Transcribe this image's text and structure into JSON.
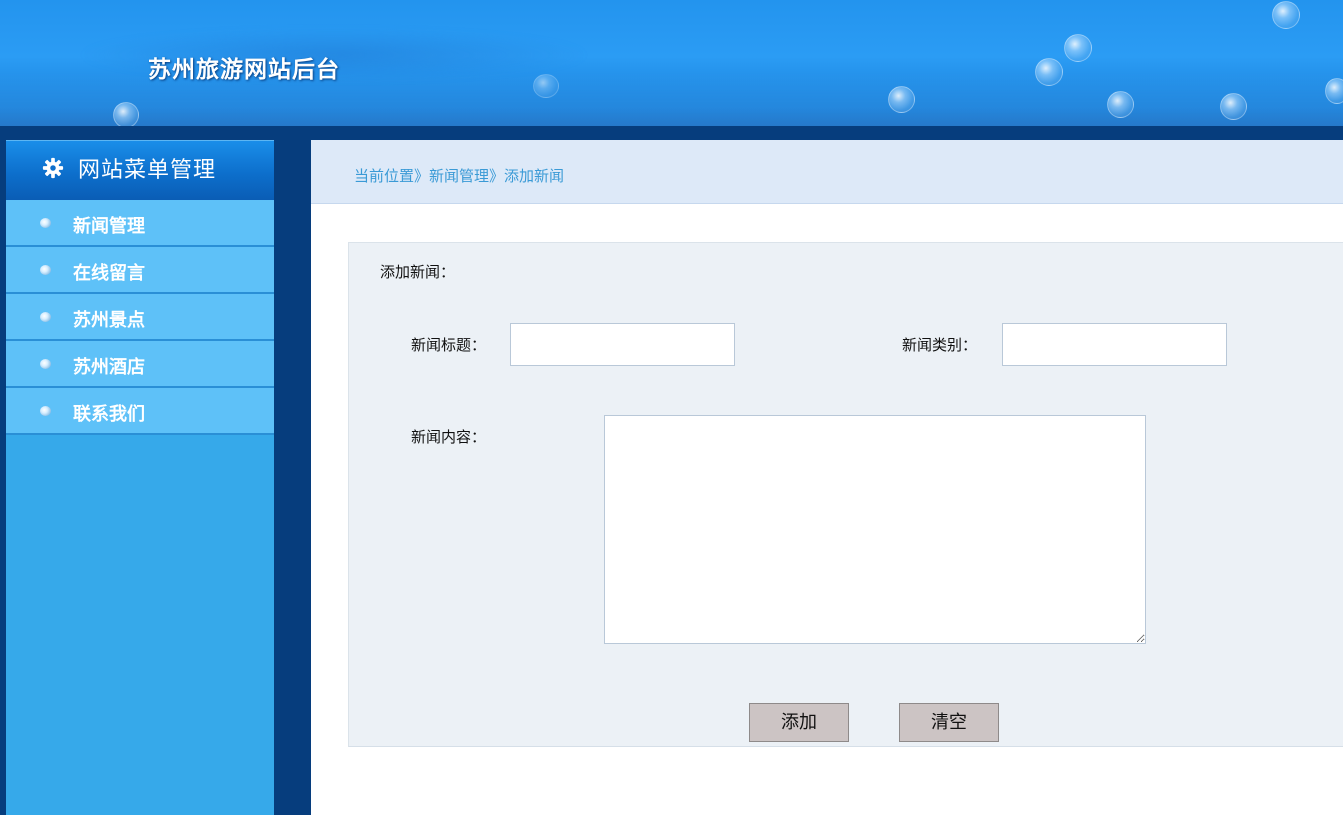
{
  "header": {
    "site_title": "苏州旅游网站后台"
  },
  "sidebar": {
    "title": "网站菜单管理",
    "title_icon": "gear-icon",
    "items": [
      {
        "label": "新闻管理"
      },
      {
        "label": "在线留言"
      },
      {
        "label": "苏州景点"
      },
      {
        "label": "苏州酒店"
      },
      {
        "label": "联系我们"
      }
    ]
  },
  "breadcrumb": {
    "text": "当前位置》新闻管理》添加新闻"
  },
  "form": {
    "heading": "添加新闻：",
    "title_label": "新闻标题：",
    "title_value": "",
    "category_label": "新闻类别：",
    "category_value": "",
    "content_label": "新闻内容：",
    "content_value": "",
    "add_button": "添加",
    "clear_button": "清空"
  },
  "colors": {
    "header_blue": "#2394ee",
    "dark_navy": "#063d7d",
    "sidebar_item": "#5ec1f8",
    "sidebar_bg": "#36a9ea",
    "breadcrumb_text": "#3a9ad6",
    "button_bg": "#ccc4c4"
  }
}
